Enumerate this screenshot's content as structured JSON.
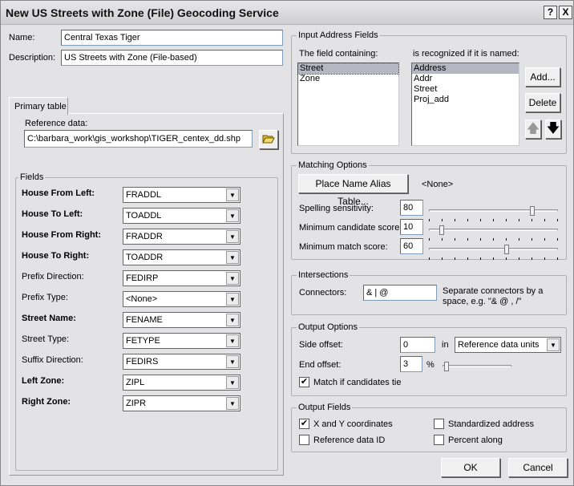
{
  "window": {
    "title": "New US Streets with Zone (File) Geocoding Service",
    "help": "?",
    "close": "X"
  },
  "name": {
    "label": "Name:",
    "value": "Central Texas Tiger"
  },
  "description": {
    "label": "Description:",
    "value": "US Streets with Zone (File-based)"
  },
  "tab": {
    "label": "Primary table"
  },
  "reference": {
    "label": "Reference data:",
    "value": "C:\\barbara_work\\gis_workshop\\TIGER_centex_dd.shp",
    "browse_icon": "open-folder-icon"
  },
  "fields": {
    "title": "Fields",
    "rows": [
      {
        "label": "House From Left:",
        "value": "FRADDL",
        "bold": true
      },
      {
        "label": "House To Left:",
        "value": "TOADDL",
        "bold": true
      },
      {
        "label": "House From Right:",
        "value": "FRADDR",
        "bold": true
      },
      {
        "label": "House To Right:",
        "value": "TOADDR",
        "bold": true
      },
      {
        "label": "Prefix Direction:",
        "value": "FEDIRP",
        "bold": false
      },
      {
        "label": "Prefix Type:",
        "value": "<None>",
        "bold": false
      },
      {
        "label": "Street Name:",
        "value": "FENAME",
        "bold": true
      },
      {
        "label": "Street Type:",
        "value": "FETYPE",
        "bold": false
      },
      {
        "label": "Suffix Direction:",
        "value": "FEDIRS",
        "bold": false
      },
      {
        "label": "Left Zone:",
        "value": "ZIPL",
        "bold": true
      },
      {
        "label": "Right Zone:",
        "value": "ZIPR",
        "bold": true
      }
    ]
  },
  "input_address": {
    "title": "Input Address Fields",
    "field_label": "The field containing:",
    "names_label": "is recognized if it is named:",
    "fields": [
      "Street",
      "Zone"
    ],
    "selected_field": "Street",
    "names": [
      "Address",
      "Addr",
      "Street",
      "Proj_add"
    ],
    "selected_name": "Address",
    "add": "Add...",
    "delete": "Delete"
  },
  "matching": {
    "title": "Matching Options",
    "alias_button": "Place Name Alias Table...",
    "alias_value": "<None>",
    "spelling": {
      "label": "Spelling sensitivity:",
      "value": "80"
    },
    "candidate": {
      "label": "Minimum candidate score:",
      "value": "10"
    },
    "match": {
      "label": "Minimum match score:",
      "value": "60"
    }
  },
  "intersections": {
    "title": "Intersections",
    "label": "Connectors:",
    "value": "& | @",
    "hint": "Separate connectors by a space, e.g. \"& @ , /\""
  },
  "output_options": {
    "title": "Output Options",
    "side_label": "Side offset:",
    "side_value": "0",
    "in": "in",
    "units": "Reference data units",
    "end_label": "End offset:",
    "end_value": "3",
    "percent": "%",
    "tie_label": "Match if candidates tie",
    "tie_checked": true,
    "end_slider_max": 50
  },
  "output_fields": {
    "title": "Output Fields",
    "items": [
      {
        "label": "X and Y coordinates",
        "checked": true
      },
      {
        "label": "Standardized address",
        "checked": false
      },
      {
        "label": "Reference data ID",
        "checked": false
      },
      {
        "label": "Percent along",
        "checked": false
      }
    ]
  },
  "buttons": {
    "ok": "OK",
    "cancel": "Cancel"
  }
}
